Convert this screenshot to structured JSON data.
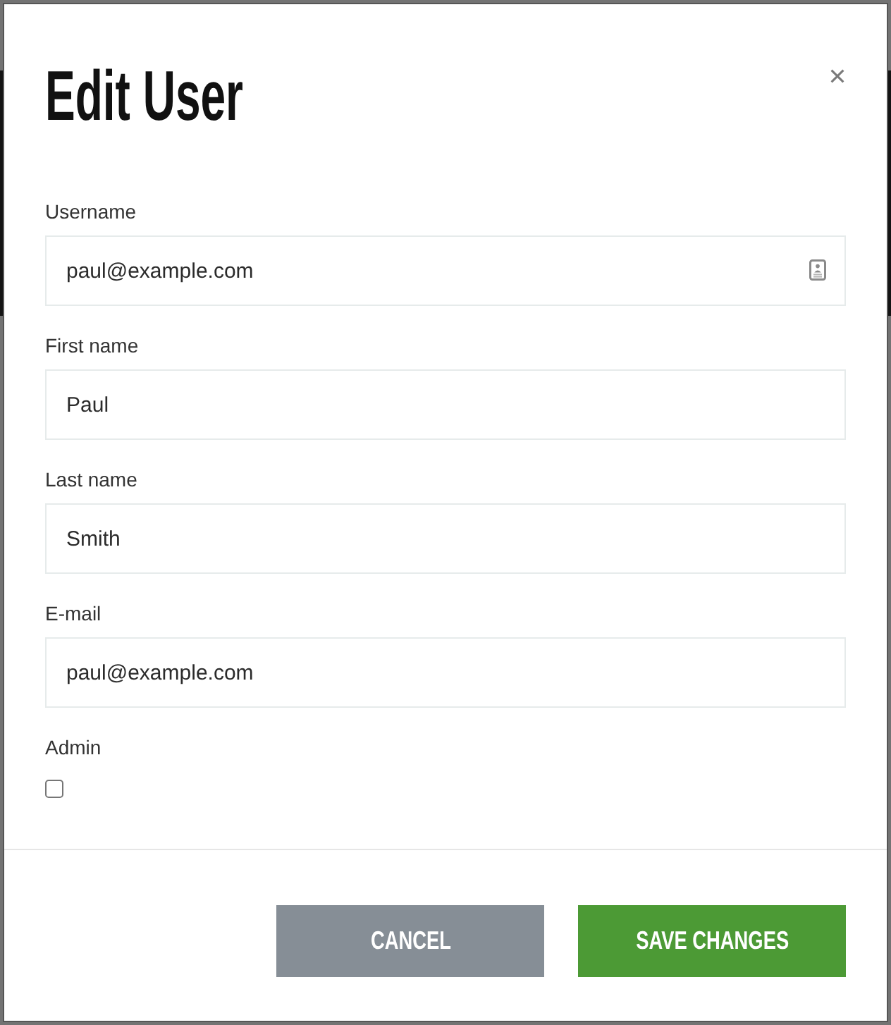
{
  "dialog": {
    "title": "Edit User"
  },
  "fields": [
    {
      "label": "Username",
      "value": "paul@example.com",
      "autofill_icon": true
    },
    {
      "label": "First name",
      "value": "Paul",
      "autofill_icon": false
    },
    {
      "label": "Last name",
      "value": "Smith",
      "autofill_icon": false
    },
    {
      "label": "E-mail",
      "value": "paul@example.com",
      "autofill_icon": false
    }
  ],
  "admin": {
    "label": "Admin",
    "checked": false
  },
  "buttons": [
    {
      "label": "CANCEL",
      "kind": "secondary"
    },
    {
      "label": "SAVE CHANGES",
      "kind": "primary"
    }
  ]
}
